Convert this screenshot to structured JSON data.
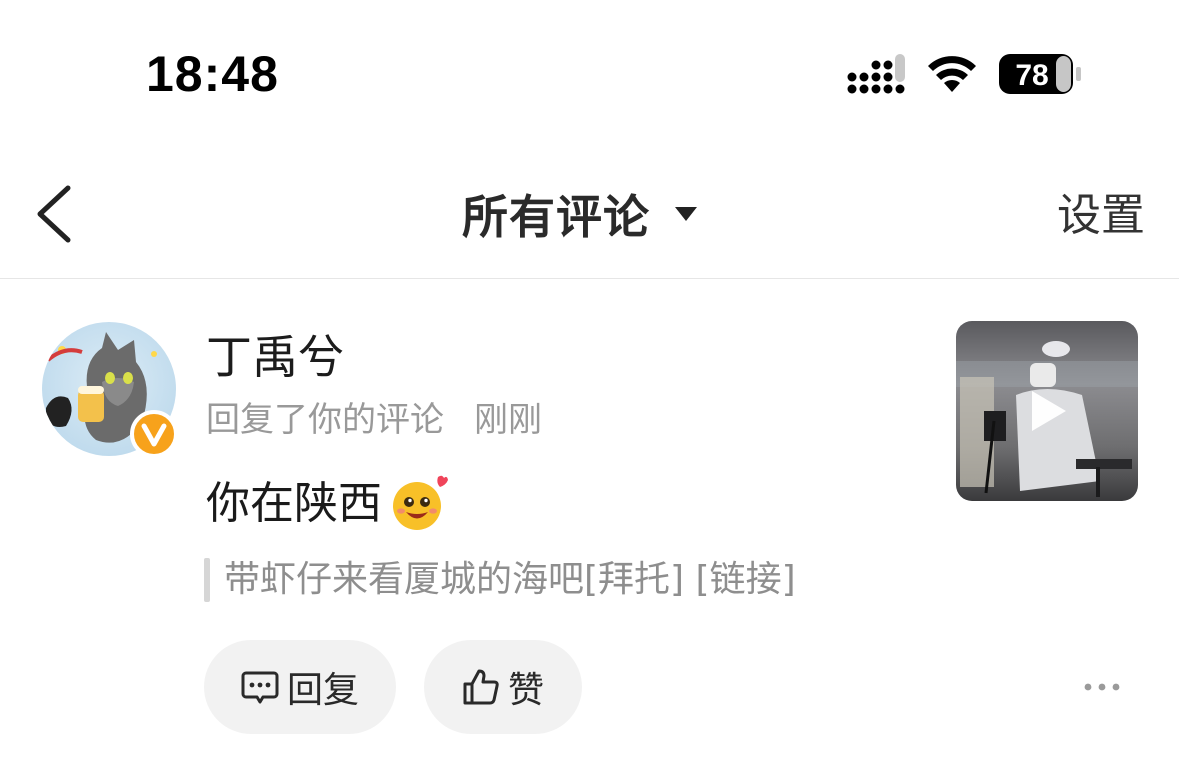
{
  "status_bar": {
    "time": "18:48",
    "battery": "78",
    "icons": [
      "signal-icon",
      "wifi-icon",
      "battery-icon"
    ]
  },
  "nav": {
    "title": "所有评论",
    "settings_label": "设置",
    "icons": [
      "back-chevron-icon",
      "caret-down-icon"
    ]
  },
  "comment": {
    "username": "丁禹兮",
    "action": "回复了你的评论",
    "time": "刚刚",
    "text": "你在陕西",
    "emoji_icon": "heart-eyes-emoji-icon",
    "quoted": "带虾仔来看厦城的海吧[拜托] [链接]",
    "actions": {
      "reply_label": "回复",
      "like_label": "赞"
    },
    "badge_icon": "verified-v-icon"
  },
  "colors": {
    "background": "#ffffff",
    "pill_background": "#f2f2f2",
    "meta_text": "#999999",
    "badge_orange": "#f7a21b"
  }
}
